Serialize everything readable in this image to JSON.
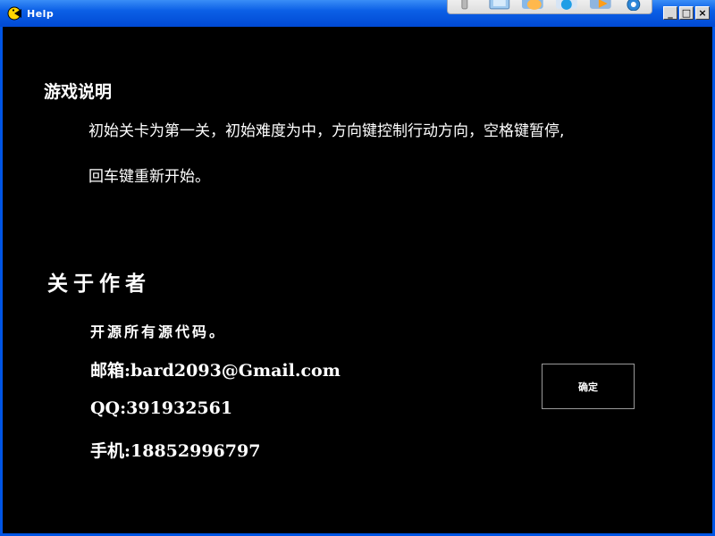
{
  "window": {
    "title": "Help",
    "icons": {
      "app": "pacman-icon",
      "minimize": "minimize-icon",
      "maximize": "maximize-icon",
      "close": "close-icon"
    },
    "buttons": {
      "minimize": "_",
      "maximize": "□",
      "close": "×"
    }
  },
  "toolbar": {
    "icons": [
      "toolbar-handle-icon",
      "toolbar-screen-icon",
      "toolbar-hand-icon",
      "toolbar-user-icon",
      "toolbar-forward-icon",
      "toolbar-help-icon"
    ]
  },
  "game_section": {
    "title": "游戏说明",
    "lines": [
      "初始关卡为第一关，初始难度为中，方向键控制行动方向，空格键暂停,",
      "回车键重新开始。"
    ]
  },
  "about_section": {
    "title": "关于作者",
    "lines": [
      "开源所有源代码。",
      "邮箱:bard2093@Gmail.com",
      "QQ:391932561",
      "手机:18852996797"
    ]
  },
  "ok_button": {
    "label": "确定"
  },
  "colors": {
    "background": "#000000",
    "text": "#ffffff",
    "titlebar": "#0b5fe6",
    "button_border": "#9a9a9a"
  }
}
